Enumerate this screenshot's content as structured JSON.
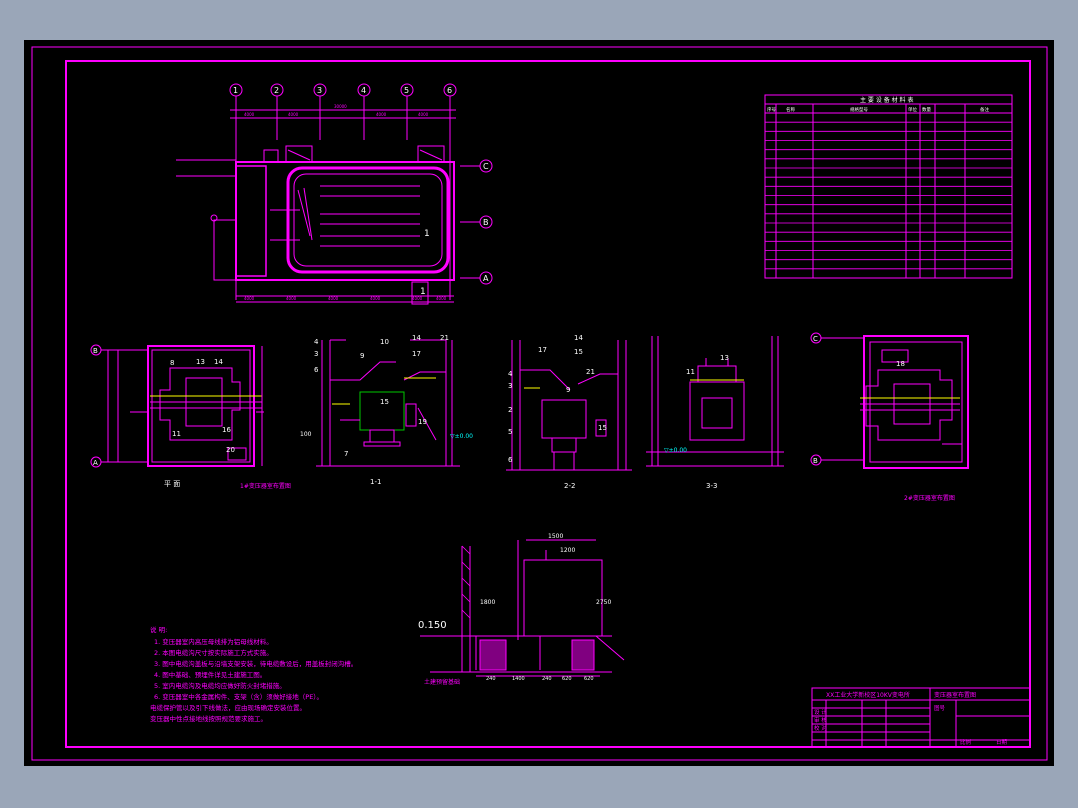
{
  "colors": {
    "bg_outer": "#9aa6b8",
    "sheet": "#000000",
    "line": "#ff00ff",
    "white": "#ffffff",
    "green": "#00c800",
    "yellow": "#ffff00",
    "cyan": "#00ffff"
  },
  "grid_markers": {
    "top": [
      "1",
      "2",
      "3",
      "4",
      "5",
      "6"
    ],
    "right": [
      "C",
      "B",
      "A"
    ]
  },
  "top_plan": {
    "dims_top": [
      "4000",
      "4000",
      "30000",
      "4000",
      "4000"
    ],
    "dims_bottom": [
      "4000",
      "4000",
      "4000",
      "4000",
      "4000",
      "4000"
    ],
    "section_mark": "1"
  },
  "section_labels": {
    "s1": "1-1",
    "s2": "2-2",
    "s3": "3-3"
  },
  "plan_labels": {
    "left_caption": "平 面",
    "left_tag": "1#变压器室布置图",
    "right_tag": "2#变压器室布置图"
  },
  "grid_letters": {
    "left_top": "B",
    "left_bottom": "A",
    "right_top": "C",
    "right_bottom": "B"
  },
  "numbers": {
    "n_7": "7",
    "n_8": "8",
    "n_9": "9",
    "n_10": "10",
    "n_11": "11",
    "n_12": "12",
    "n_13": "13",
    "n_14": "14",
    "n_15": "15",
    "n_16": "16",
    "n_17": "17",
    "n_18": "18",
    "n_19": "19",
    "n_20": "20",
    "n_21": "21",
    "n_1": "1",
    "n_2": "2",
    "n_3": "3",
    "n_4": "4",
    "n_5": "5",
    "n_6": "6",
    "dim_100": "100",
    "dim_plus0": "▽±0.00"
  },
  "foundation": {
    "dim_top1": "1500",
    "dim_top2": "1200",
    "elev": "0.150",
    "height": "2750",
    "left_dim": "1800",
    "label_left": "土建预留基础",
    "bottom_dims": [
      "240",
      "1400",
      "240",
      "620",
      "620"
    ]
  },
  "notes": {
    "title": "说 明:",
    "lines": [
      "1. 变压器室内高压母线排为铝母线材料。",
      "2. 本图电缆沟尺寸按实际施工方式实施。",
      "3. 图中电缆沟盖板与沿墙支架安装，待电缆敷设后，用盖板封闭沟槽。",
      "4. 图中基础、预埋件详见土建施工图。",
      "5. 室内电缆沟及电缆均应做好防火封堵措施。",
      "6. 变压器室中各金属构件、支架（含）须做好接地（PE）。",
      "电缆保护管以及引下线做法，应由现场确定安装位置。",
      "变压器中性点接地线按照规范要求施工。"
    ]
  },
  "title_block": {
    "project": "XX工业大学新校区10KV变电所",
    "drawing": "变压器室布置图",
    "rows": [
      "设 计",
      "审 核",
      "校 对"
    ],
    "code": "图号",
    "scale": "比例",
    "date": "日期"
  },
  "legend_table": {
    "title": "主 要 设 备 材 料 表",
    "headers": [
      "序号",
      "名称",
      "规格型号",
      "单位",
      "数量",
      "备注"
    ],
    "rows": 18
  }
}
